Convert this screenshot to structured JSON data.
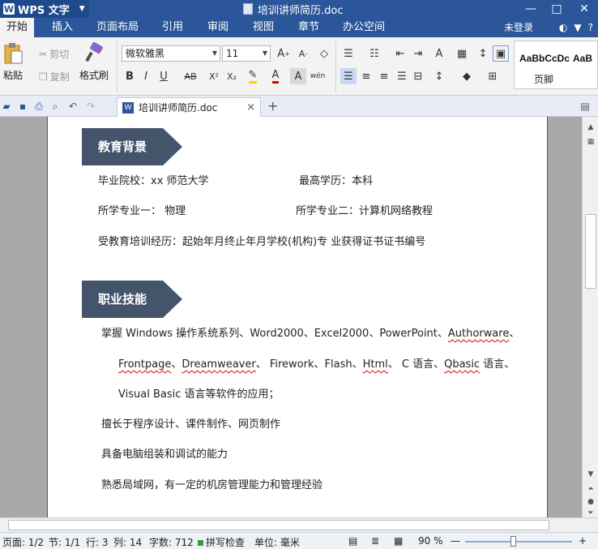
{
  "app": {
    "name": "WPS 文字",
    "doc_title": "培训讲师简历.doc"
  },
  "window": {
    "minimize": "—",
    "maximize": "□",
    "close": "✕"
  },
  "tabs": [
    {
      "label": "开始"
    },
    {
      "label": "插入"
    },
    {
      "label": "页面布局"
    },
    {
      "label": "引用"
    },
    {
      "label": "审阅"
    },
    {
      "label": "视图"
    },
    {
      "label": "章节"
    },
    {
      "label": "办公空间"
    }
  ],
  "login": "未登录",
  "tab_icons": {
    "skin": "◐",
    "shirt": "▼",
    "help": "?"
  },
  "ribbon": {
    "paste": "粘贴",
    "cut": "剪切",
    "copy": "复制",
    "format_painter": "格式刷",
    "font_name": "微软雅黑",
    "font_size": "11",
    "bold": "B",
    "italic": "I",
    "underline": "U",
    "strike": "AB",
    "superscript": "X²",
    "subscript": "X₂",
    "style_samples": [
      "AaBbCcDc",
      "AaB"
    ],
    "style_name": "页脚"
  },
  "doc_tab": {
    "label": "培训讲师简历.doc",
    "close": "×",
    "add": "+"
  },
  "document": {
    "education_title": "教育背景",
    "school": "毕业院校：xx 师范大学",
    "degree": "最高学历：本科",
    "major1": "所学专业一：  物理",
    "major2": "所学专业二：计算机网络教程",
    "training": "受教育培训经历：起始年月终止年月学校(机构)专    业获得证书证书编号",
    "skills_title": "职业技能",
    "skill_line1_a": "掌握 Windows 操作系统系列、Word2000、Excel2000、PowerPoint、",
    "skill_line1_b": "Authorware",
    "skill_line1_c": "、",
    "skill_line2_parts": [
      "Frontpage",
      "、",
      "Dreamweaver",
      "、 Firework、Flash、",
      "Html",
      "、 C 语言、",
      "Qbasic",
      " 语言、"
    ],
    "skill_line3": "Visual  Basic 语言等软件的应用；",
    "skill_2": "擅长于程序设计、课件制作、网页制作",
    "skill_3": "具备电脑组装和调试的能力",
    "skill_4": "熟悉局域网，有一定的机房管理能力和管理经验"
  },
  "status": {
    "page": "页面: 1/2",
    "section": "节: 1/1",
    "row": "行: 3",
    "col": "列: 14",
    "words": "字数: 712",
    "spell": "拼写检查",
    "unit": "单位: 毫米",
    "zoom": "90 %",
    "zoom_out": "—",
    "zoom_in": "+"
  },
  "colors": {
    "accent": "#2b579a",
    "section_head": "#44546a"
  }
}
